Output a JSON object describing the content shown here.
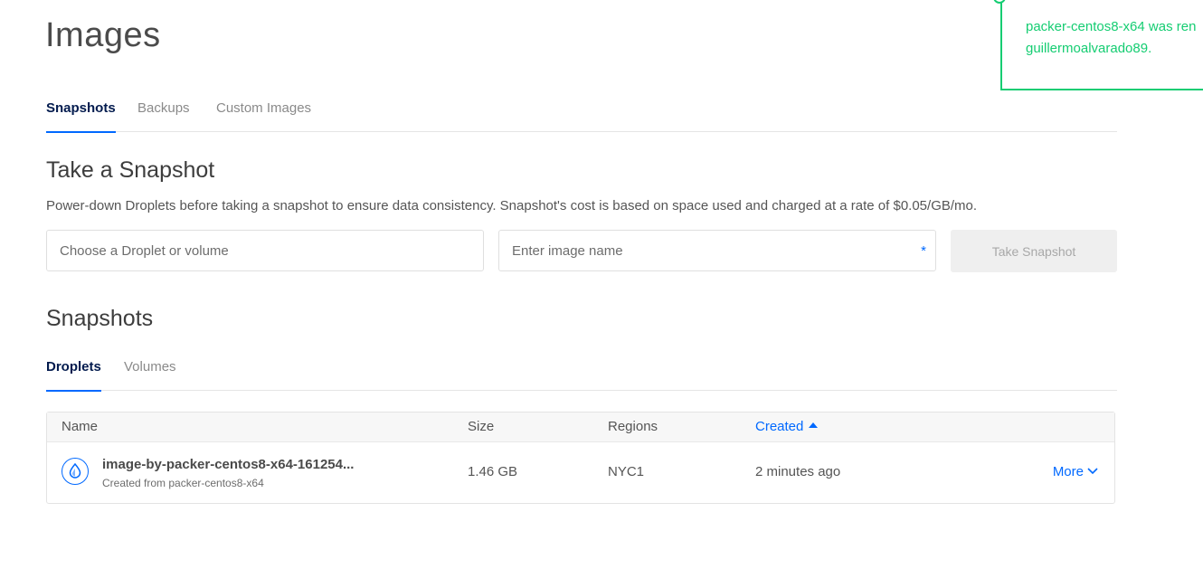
{
  "page": {
    "title": "Images"
  },
  "tabs": [
    {
      "label": "Snapshots",
      "active": true
    },
    {
      "label": "Backups",
      "active": false
    },
    {
      "label": "Custom Images",
      "active": false
    }
  ],
  "take_snapshot": {
    "title": "Take a Snapshot",
    "description": "Power-down Droplets before taking a snapshot to ensure data consistency. Snapshot's cost is based on space used and charged at a rate of $0.05/GB/mo.",
    "source_placeholder": "Choose a Droplet or volume",
    "name_placeholder": "Enter image name",
    "required_marker": "*",
    "button_label": "Take Snapshot"
  },
  "snapshots": {
    "title": "Snapshots",
    "subtabs": [
      {
        "label": "Droplets",
        "active": true
      },
      {
        "label": "Volumes",
        "active": false
      }
    ],
    "columns": {
      "name": "Name",
      "size": "Size",
      "regions": "Regions",
      "created": "Created"
    },
    "rows": [
      {
        "name": "image-by-packer-centos8-x64-161254...",
        "source": "Created from packer-centos8-x64",
        "size": "1.46 GB",
        "regions": "NYC1",
        "created": "2 minutes ago",
        "action": "More",
        "icon": "droplet-icon"
      }
    ]
  },
  "toast": {
    "line1": "packer-centos8-x64 was ren",
    "line2": "guillermoalvarado89."
  },
  "colors": {
    "accent": "#0069ff",
    "nav_active": "#031b4e",
    "success": "#15cd72"
  }
}
